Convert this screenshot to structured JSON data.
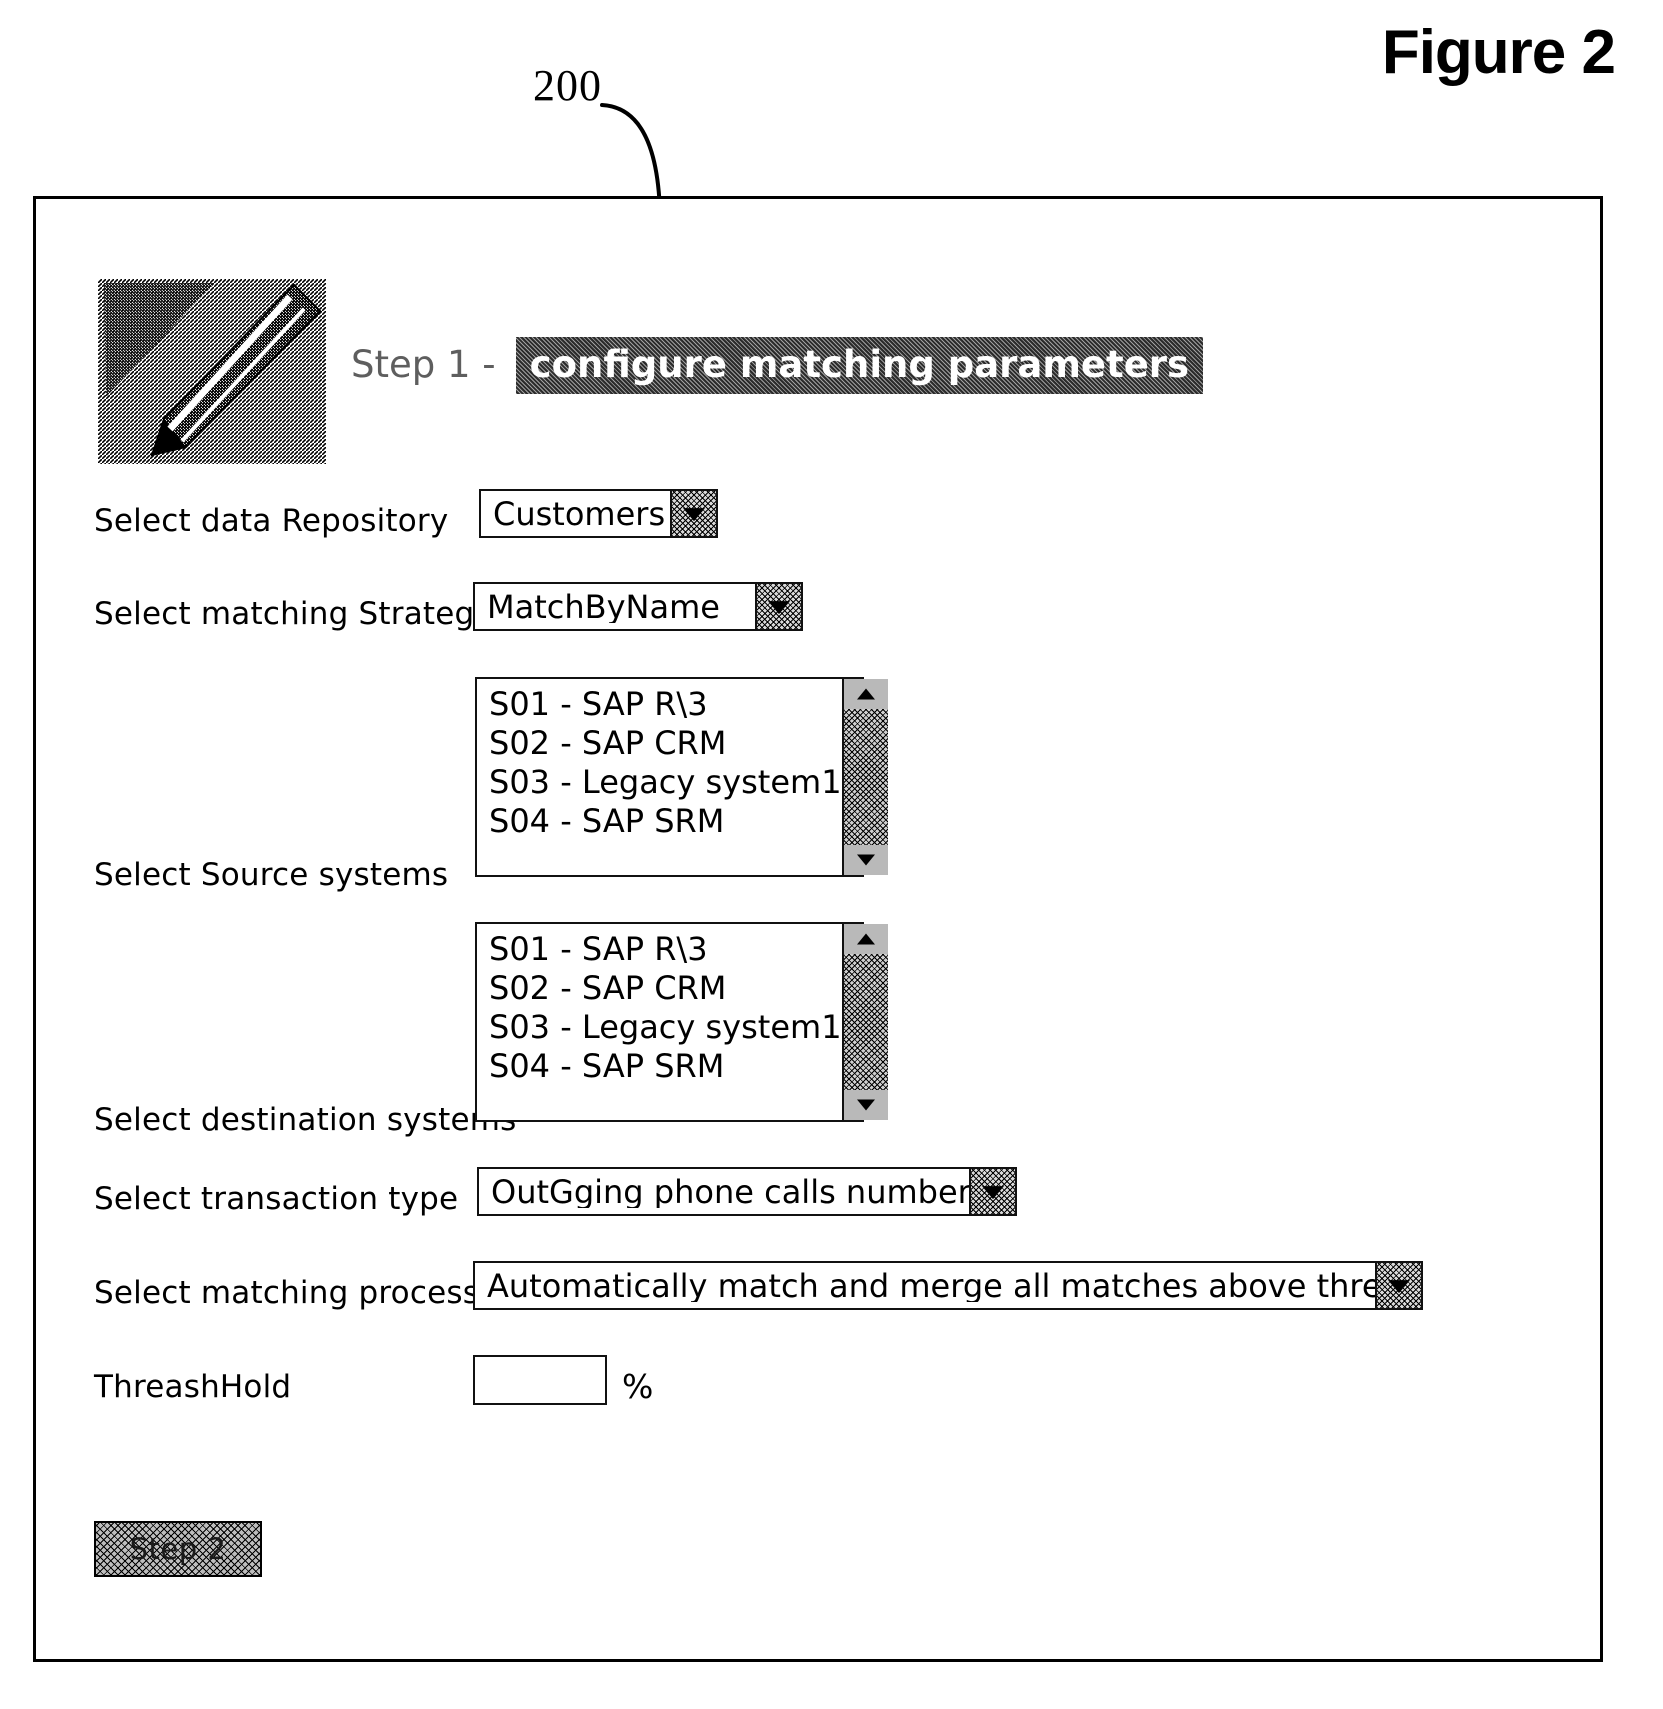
{
  "figure": {
    "label": "Figure 2",
    "callout_number": "200"
  },
  "dialog": {
    "logo_icon": "pencil-diagonal-icon",
    "title": {
      "step_text": "Step 1 -",
      "highlighted_text": "configure matching parameters"
    },
    "fields": {
      "repository": {
        "label": "Select data Repository",
        "value": "Customers",
        "arrow_icon": "chevron-down-icon"
      },
      "strategy": {
        "label": "Select matching Strategy",
        "value": "MatchByName",
        "arrow_icon": "chevron-down-icon"
      },
      "source_systems": {
        "label": "Select Source systems",
        "items": [
          "S01 - SAP R\\3",
          "S02 - SAP CRM",
          "S03 - Legacy system1",
          "S04 - SAP SRM"
        ],
        "scroll_up_icon": "scroll-up-icon",
        "scroll_down_icon": "scroll-down-icon"
      },
      "destination_systems": {
        "label": "Select destination systems",
        "items": [
          "S01 - SAP R\\3",
          "S02 - SAP CRM",
          "S03 - Legacy system1",
          "S04 - SAP SRM"
        ],
        "scroll_up_icon": "scroll-up-icon",
        "scroll_down_icon": "scroll-down-icon"
      },
      "transaction_type": {
        "label": "Select transaction type",
        "value": "OutGging phone calls numbers",
        "arrow_icon": "chevron-down-icon"
      },
      "matching_process": {
        "label": "Select matching process",
        "value": "Automatically match and merge all matches above threashhold",
        "arrow_icon": "chevron-down-icon"
      },
      "threshold": {
        "label": "ThreashHold",
        "value": "",
        "unit": "%"
      }
    },
    "actions": {
      "next_step": "Step 2"
    }
  },
  "colors": {
    "ink": "#000000",
    "paper": "#ffffff",
    "control_gray": "#cfcfcf",
    "highlight_bg": "#2b2b2b",
    "highlight_fg": "#ffffff"
  }
}
